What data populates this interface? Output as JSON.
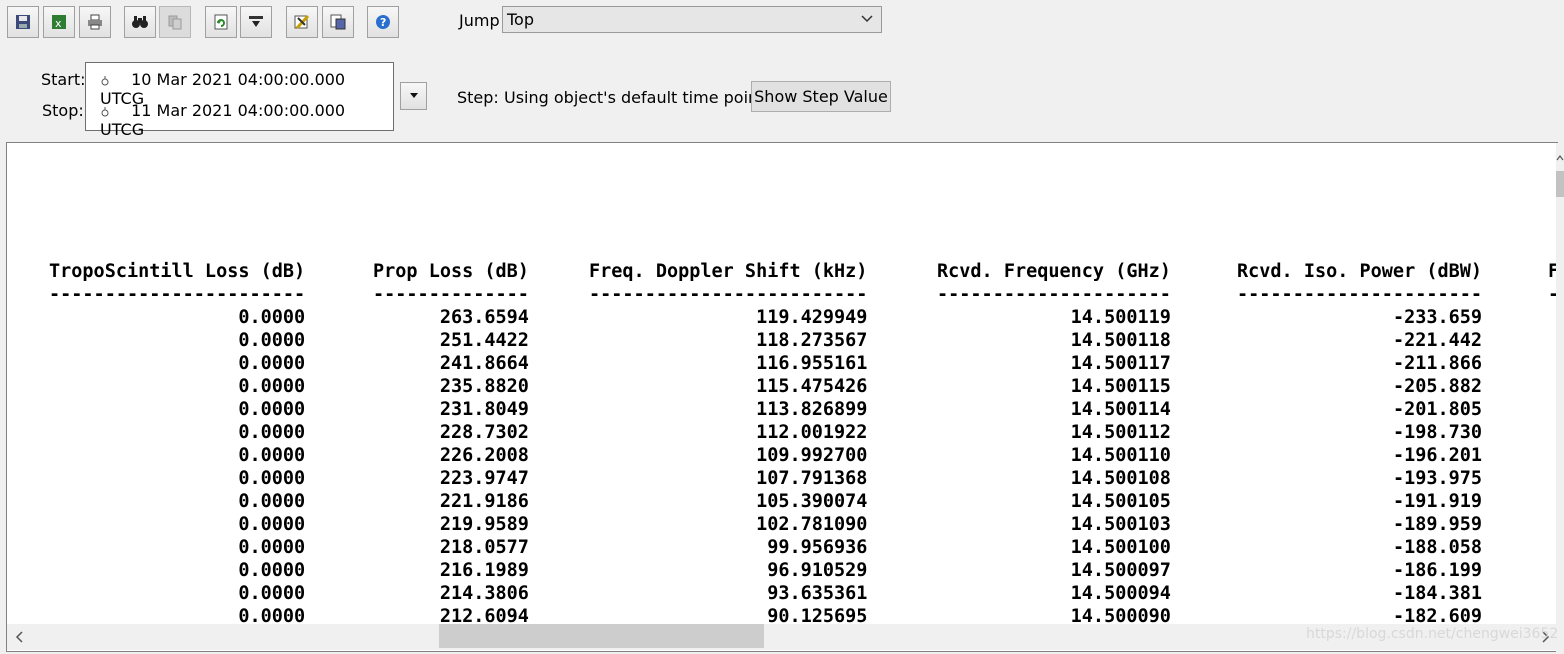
{
  "toolbar": {
    "buttons": [
      {
        "icon": "save-icon"
      },
      {
        "icon": "excel-export-icon"
      },
      {
        "icon": "print-icon"
      },
      {
        "icon": "find-icon"
      },
      {
        "icon": "copy-icon"
      },
      {
        "icon": "refresh-icon"
      },
      {
        "icon": "download-icon"
      },
      {
        "icon": "properties-icon"
      },
      {
        "icon": "report-options-icon"
      },
      {
        "icon": "help-icon"
      }
    ]
  },
  "jump": {
    "label": "Jump",
    "value": "Top"
  },
  "time": {
    "start_label": "Start:",
    "stop_label": "Stop:",
    "start_value": "10 Mar 2021 04:00:00.000 UTCG",
    "stop_value": "11 Mar 2021 04:00:00.000 UTCG"
  },
  "step": {
    "label": "Step:",
    "value": "Using object's default time points",
    "button_label": "Show Step Value"
  },
  "table": {
    "columns": [
      {
        "header": "TropoScintill Loss (dB)",
        "dashes": "-----------------------"
      },
      {
        "header": "Prop Loss (dB)",
        "dashes": "--------------"
      },
      {
        "header": "Freq. Doppler Shift (kHz)",
        "dashes": "-------------------------"
      },
      {
        "header": "Rcvd. Frequency (GHz)",
        "dashes": "---------------------"
      },
      {
        "header": "Rcvd. Iso. Power (dBW)",
        "dashes": "----------------------"
      },
      {
        "header": "F",
        "dashes": "-"
      }
    ],
    "rows": [
      [
        "0.0000",
        "263.6594",
        "119.429949",
        "14.500119",
        "-233.659"
      ],
      [
        "0.0000",
        "251.4422",
        "118.273567",
        "14.500118",
        "-221.442"
      ],
      [
        "0.0000",
        "241.8664",
        "116.955161",
        "14.500117",
        "-211.866"
      ],
      [
        "0.0000",
        "235.8820",
        "115.475426",
        "14.500115",
        "-205.882"
      ],
      [
        "0.0000",
        "231.8049",
        "113.826899",
        "14.500114",
        "-201.805"
      ],
      [
        "0.0000",
        "228.7302",
        "112.001922",
        "14.500112",
        "-198.730"
      ],
      [
        "0.0000",
        "226.2008",
        "109.992700",
        "14.500110",
        "-196.201"
      ],
      [
        "0.0000",
        "223.9747",
        "107.791368",
        "14.500108",
        "-193.975"
      ],
      [
        "0.0000",
        "221.9186",
        "105.390074",
        "14.500105",
        "-191.919"
      ],
      [
        "0.0000",
        "219.9589",
        "102.781090",
        "14.500103",
        "-189.959"
      ],
      [
        "0.0000",
        "218.0577",
        "99.956936",
        "14.500100",
        "-188.058"
      ],
      [
        "0.0000",
        "216.1989",
        "96.910529",
        "14.500097",
        "-186.199"
      ],
      [
        "0.0000",
        "214.3806",
        "93.635361",
        "14.500094",
        "-184.381"
      ],
      [
        "0.0000",
        "212.6094",
        "90.125695",
        "14.500090",
        "-182.609"
      ]
    ]
  },
  "watermark": "https://blog.csdn.net/chengwei3652"
}
